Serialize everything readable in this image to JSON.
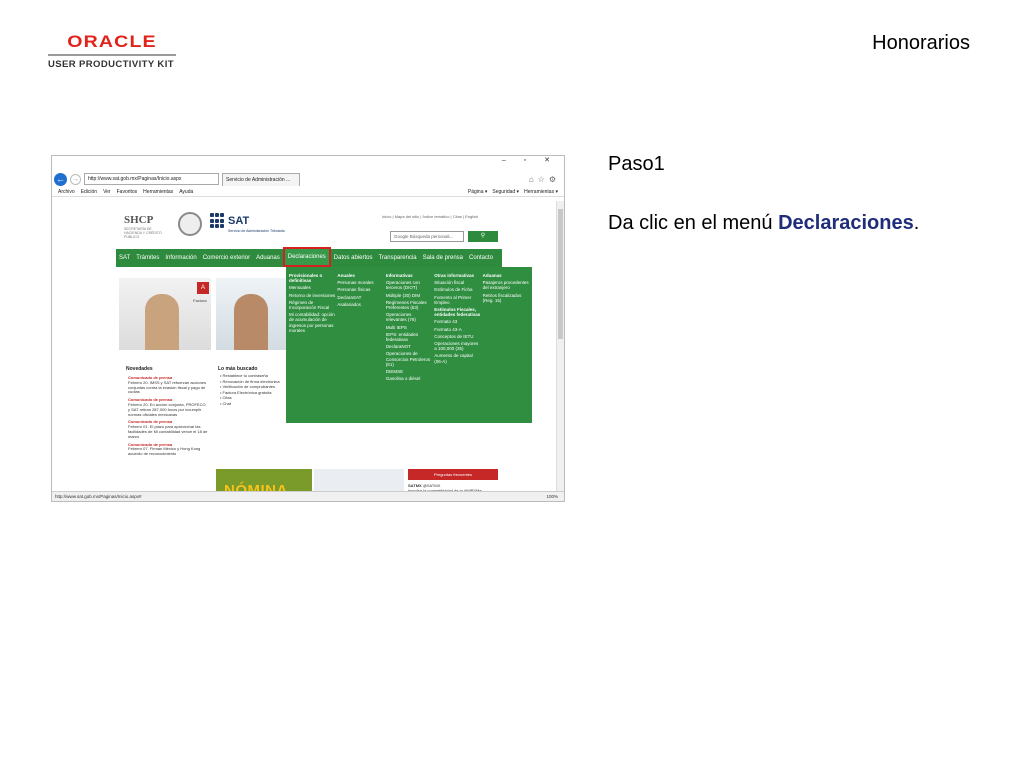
{
  "logo": {
    "brand": "ORACLE",
    "tagline": "USER PRODUCTIVITY KIT"
  },
  "header": {
    "title": "Honorarios"
  },
  "step": {
    "label": "Paso1"
  },
  "instruction": {
    "prefix": "Da clic en el menú ",
    "target": "Declaraciones",
    "suffix": "."
  },
  "browser": {
    "window_controls": "– ▫ ✕",
    "address": "http://www.sat.gob.mx/Paginas/Inicio.aspx",
    "tab": "Servicio de Administración ...",
    "menu": [
      "Archivo",
      "Edición",
      "Ver",
      "Favoritos",
      "Herramientas",
      "Ayuda"
    ],
    "commands": [
      "Página ▾",
      "Seguridad ▾",
      "Herramientas ▾"
    ],
    "status_url": "http://www.sat.gob.mx/Paginas/Inicio.aspx#",
    "zoom": "100%"
  },
  "site": {
    "shcp": "SHCP",
    "shcp_sub": "SECRETARÍA DE HACIENDA Y CRÉDITO PÚBLICO",
    "sat": "SAT",
    "sat_sub": "Servicio de Administración Tributaria",
    "toplinks": "Inicio | Mapa del sitio | Índice temático | Citas | English",
    "search_placeholder": "Google Búsqueda personali...",
    "nav": [
      "SAT",
      "Trámites",
      "Información",
      "Comercio exterior",
      "Aduanas",
      "Declaraciones",
      "Datos abiertos",
      "Transparencia",
      "Sala de prensa",
      "Contacto"
    ],
    "dropdown": [
      {
        "heading": "Provisionales o definitivas",
        "items": [
          "Mensuales",
          "Retorno de inversiones",
          "Régimen de Incorporación Fiscal",
          "Mi contabilidad: opción de acumulación de ingresos por personas morales"
        ]
      },
      {
        "heading": "Anuales",
        "items": [
          "Personas morales",
          "Personas físicas",
          "DeclaraSAT",
          "Asalariados"
        ]
      },
      {
        "heading": "Informativas",
        "items": [
          "Operaciones con terceros (DIOT)",
          "Múltiple (30) DIM",
          "Regímenes Fiscales Preferentes (63)",
          "Operaciones relevantes (76)",
          "Multi IEPS",
          "IEPS: entidades federativas",
          "DeclaraNOT",
          "Operaciones de Consorcios Petroleros (81)",
          "DIEMSE",
          "Gasolina o diésel"
        ]
      },
      {
        "heading": "Otras informativas",
        "items": [
          "Situación fiscal",
          "Estímulos de Ficha",
          "Fomento al Primer Empleo",
          "Estímulos Fiscales, entidades federativas",
          "Formato 43",
          "Formato 43-A",
          "Conceptos de IETU",
          "Operaciones mayores a 100,000 (35)",
          "Aumento de capital (06-A)"
        ]
      },
      {
        "heading": "Aduanas",
        "items": [
          "Pasajeros procedentes del extranjero",
          "Retiros fiscalizados (Reg. 15)"
        ]
      }
    ],
    "tile_badge": "A",
    "tile_label": "Factura",
    "novedades_title": "Novedades",
    "novedades": [
      {
        "title": "Comunicado de prensa",
        "text": "Febrero 20. IMSS y SAT refuerzan acciones conjuntas contra la evasión fiscal y pago de cuotas"
      },
      {
        "title": "Comunicado de prensa",
        "text": "Febrero 20. En acción conjunta, PROFECO y SAT retiran 287,000 focos por incumplir normas oficiales mexicanas"
      },
      {
        "title": "Comunicado de prensa",
        "text": "Febrero 01. El plazo para aprovechar las facilidades de Mi contabilidad vence el 18 de marzo"
      },
      {
        "title": "Comunicado de prensa",
        "text": "Febrero 07. Firman México y Hong Kong acuerdo de reconocimiento"
      }
    ],
    "popular_title": "Lo más buscado",
    "popular": [
      "• Restablece tu contraseña",
      "• Renovación de firma electrónica",
      "• Verificación de comprobantes",
      "• Factura Electrónica gratuita",
      "• Citas",
      "• Chat"
    ],
    "nomina": "NÓMINA DIGITAL",
    "preguntas": "Preguntas frecuentes",
    "tweet_user": "SATMX",
    "tweet_handle": "@SATMX",
    "tweet_text": "Impulsa la competitividad de tu #MIPYMe, reinvierte en ella y deduce"
  }
}
